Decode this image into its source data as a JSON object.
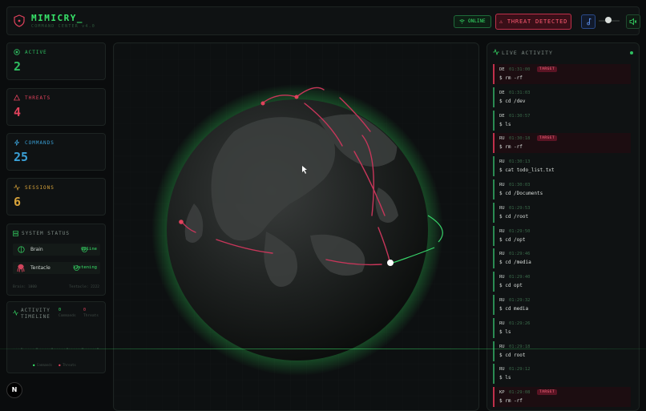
{
  "header": {
    "brand": "MIMICRY_",
    "subtitle": "COMMAND CENTER v4.0",
    "online_label": "ONLINE",
    "threat_label": "⚠ THREAT DETECTED"
  },
  "stats": [
    {
      "label": "ACTIVE",
      "value": "2",
      "color": "#2fbf61",
      "icon": "target-icon"
    },
    {
      "label": "THREATS",
      "value": "4",
      "color": "#e0425c",
      "icon": "alert-triangle-icon"
    },
    {
      "label": "COMMANDS",
      "value": "25",
      "color": "#3aa0d6",
      "icon": "zap-icon"
    },
    {
      "label": "SESSIONS",
      "value": "6",
      "color": "#d6a23a",
      "icon": "activity-icon"
    }
  ],
  "system_status": {
    "title": "SYSTEM STATUS",
    "rows": [
      {
        "name": "Brain",
        "value": "Online"
      },
      {
        "name": "Tentacle",
        "value": "Listening"
      }
    ],
    "footer_left": "Brain: 1000",
    "footer_right": "Tentacle: 2222"
  },
  "timeline": {
    "title_line1": "ACTIVITY",
    "title_line2": "TIMELINE",
    "commands_count": "0",
    "commands_label": "Commands",
    "threats_count": "0",
    "threats_label": "Threats",
    "legend_commands": "Commands",
    "legend_threats": "Threats"
  },
  "activity": {
    "title": "LIVE ACTIVITY",
    "items": [
      {
        "country": "DE",
        "time": "01:31:00",
        "target": true,
        "cmd": "$ rm -rf"
      },
      {
        "country": "DE",
        "time": "01:31:03",
        "target": false,
        "cmd": "$ cd /dev"
      },
      {
        "country": "DE",
        "time": "01:30:57",
        "target": false,
        "cmd": "$ ls"
      },
      {
        "country": "RU",
        "time": "01:30:18",
        "target": true,
        "cmd": "$ rm -rf"
      },
      {
        "country": "RU",
        "time": "01:30:13",
        "target": false,
        "cmd": "$ cat todo_list.txt"
      },
      {
        "country": "RU",
        "time": "01:30:03",
        "target": false,
        "cmd": "$ cd /Documents"
      },
      {
        "country": "RU",
        "time": "01:29:53",
        "target": false,
        "cmd": "$ cd /root"
      },
      {
        "country": "RU",
        "time": "01:29:50",
        "target": false,
        "cmd": "$ cd /opt"
      },
      {
        "country": "RU",
        "time": "01:29:46",
        "target": false,
        "cmd": "$ cd /media"
      },
      {
        "country": "RU",
        "time": "01:29:40",
        "target": false,
        "cmd": "$ cd opt"
      },
      {
        "country": "RU",
        "time": "01:29:32",
        "target": false,
        "cmd": "$ cd media"
      },
      {
        "country": "RU",
        "time": "01:29:26",
        "target": false,
        "cmd": "$ ls"
      },
      {
        "country": "RU",
        "time": "01:29:18",
        "target": false,
        "cmd": "$ cd root"
      },
      {
        "country": "RU",
        "time": "01:29:12",
        "target": false,
        "cmd": "$ ls"
      },
      {
        "country": "KP",
        "time": "01:29:08",
        "target": true,
        "cmd": "$ rm -rf"
      }
    ],
    "target_badge": "TARGET"
  },
  "colors": {
    "accent": "#38e36a",
    "threat": "#e0425c",
    "arc": "#c8365a"
  },
  "badge_letter": "N"
}
